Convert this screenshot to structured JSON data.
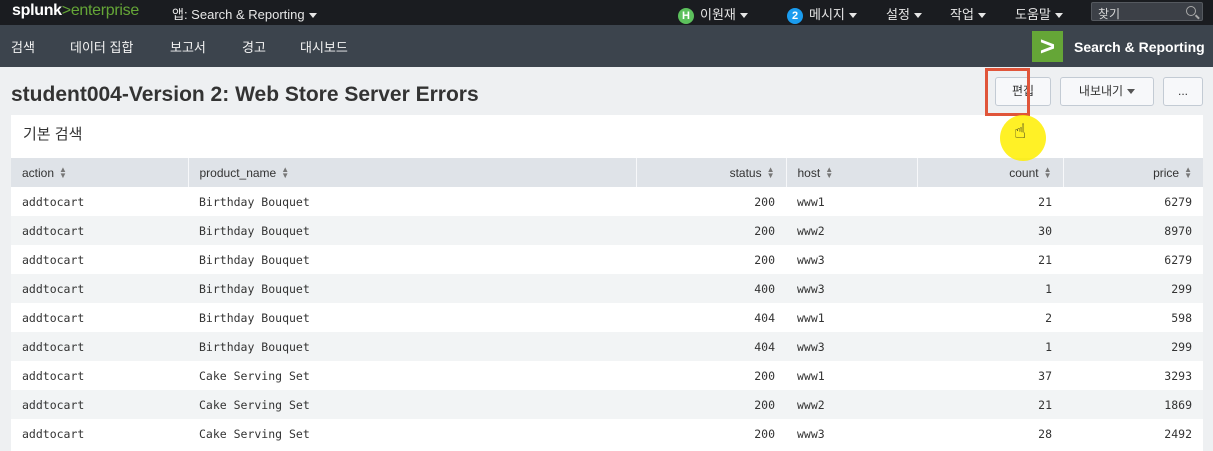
{
  "topbar": {
    "logo_splunk": "splunk",
    "logo_gt": ">",
    "logo_enterprise": "enterprise",
    "app_menu": "앱: Search & Reporting",
    "user_badge": "H",
    "user_name": "이원재",
    "messages_badge": "2",
    "messages_label": "메시지",
    "settings_label": "설정",
    "activity_label": "작업",
    "help_label": "도움말",
    "find_placeholder": "찾기"
  },
  "nav": {
    "items": [
      "검색",
      "데이터 집합",
      "보고서",
      "경고",
      "대시보드"
    ],
    "brand_icon": ">",
    "brand_label": "Search & Reporting"
  },
  "header": {
    "title": "student004-Version 2: Web Store Server Errors",
    "edit_label": "편집",
    "export_label": "내보내기",
    "more_label": "..."
  },
  "panel": {
    "title": "기본 검색",
    "columns": [
      "action",
      "product_name",
      "status",
      "host",
      "count",
      "price"
    ],
    "rows": [
      [
        "addtocart",
        "Birthday Bouquet",
        "200",
        "www1",
        "21",
        "6279"
      ],
      [
        "addtocart",
        "Birthday Bouquet",
        "200",
        "www2",
        "30",
        "8970"
      ],
      [
        "addtocart",
        "Birthday Bouquet",
        "200",
        "www3",
        "21",
        "6279"
      ],
      [
        "addtocart",
        "Birthday Bouquet",
        "400",
        "www3",
        "1",
        "299"
      ],
      [
        "addtocart",
        "Birthday Bouquet",
        "404",
        "www1",
        "2",
        "598"
      ],
      [
        "addtocart",
        "Birthday Bouquet",
        "404",
        "www3",
        "1",
        "299"
      ],
      [
        "addtocart",
        "Cake Serving Set",
        "200",
        "www1",
        "37",
        "3293"
      ],
      [
        "addtocart",
        "Cake Serving Set",
        "200",
        "www2",
        "21",
        "1869"
      ],
      [
        "addtocart",
        "Cake Serving Set",
        "200",
        "www3",
        "28",
        "2492"
      ]
    ]
  },
  "colors": {
    "brand_green": "#65a637",
    "highlight_red": "#e0553a",
    "cursor_yellow": "#ffee00",
    "topbar_bg": "#1a1c20",
    "navbar_bg": "#3c444d"
  }
}
